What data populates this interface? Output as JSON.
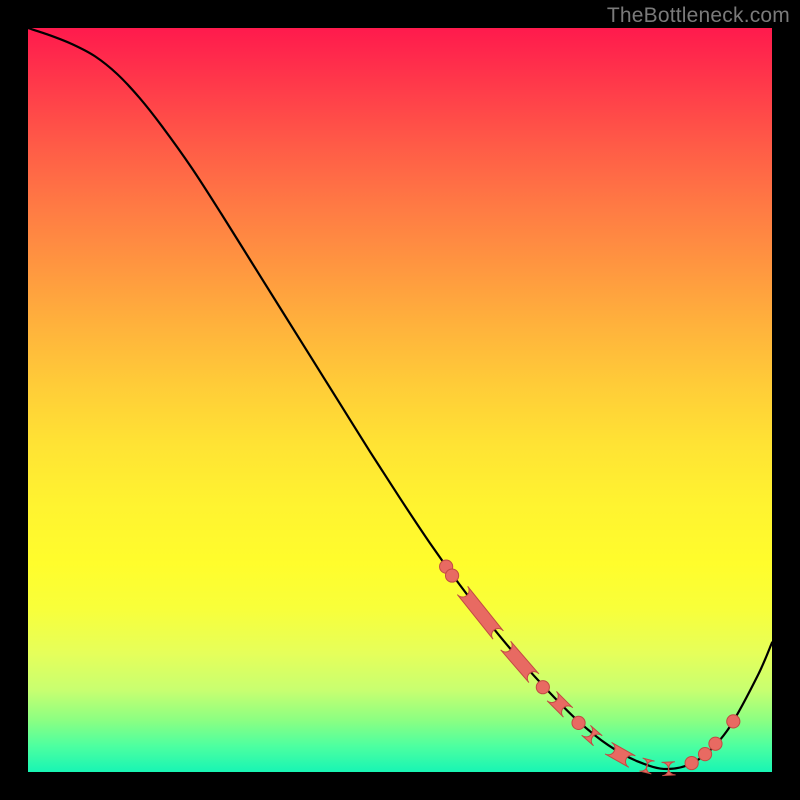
{
  "watermark": "TheBottleneck.com",
  "colors": {
    "curve": "#000000",
    "marker_fill": "#e86a62",
    "marker_stroke": "#c24b43"
  },
  "chart_data": {
    "type": "line",
    "title": "",
    "xlabel": "",
    "ylabel": "",
    "xlim": [
      0,
      100
    ],
    "ylim": [
      0,
      100
    ],
    "series": [
      {
        "name": "bottleneck-curve",
        "x": [
          0,
          3,
          6,
          9,
          12,
          15,
          18,
          22,
          26,
          30,
          34,
          38,
          42,
          46,
          50,
          54,
          58,
          62,
          66,
          70,
          74,
          78,
          82,
          86,
          90,
          94,
          98,
          100
        ],
        "y": [
          100,
          99,
          97.8,
          96.2,
          93.8,
          90.6,
          86.8,
          81.2,
          75.0,
          68.6,
          62.2,
          55.8,
          49.4,
          43.0,
          36.8,
          30.8,
          25.2,
          20.0,
          15.2,
          10.8,
          6.8,
          3.6,
          1.4,
          0.4,
          1.6,
          5.6,
          12.8,
          17.4
        ]
      }
    ],
    "markers": [
      {
        "kind": "dot",
        "x": 56.2,
        "y": 27.6
      },
      {
        "kind": "dot",
        "x": 57.0,
        "y": 26.4
      },
      {
        "kind": "lozenge",
        "x0": 58.4,
        "y0": 24.4,
        "x1": 63.2,
        "y1": 18.4
      },
      {
        "kind": "lozenge",
        "x0": 64.2,
        "y0": 17.0,
        "x1": 68.0,
        "y1": 12.6
      },
      {
        "kind": "dot",
        "x": 69.2,
        "y": 11.4
      },
      {
        "kind": "lozenge",
        "x0": 70.4,
        "y0": 10.2,
        "x1": 72.6,
        "y1": 8.0
      },
      {
        "kind": "dot",
        "x": 74.0,
        "y": 6.6
      },
      {
        "kind": "lozenge",
        "x0": 75.0,
        "y0": 5.6,
        "x1": 76.6,
        "y1": 4.2
      },
      {
        "kind": "lozenge",
        "x0": 78.0,
        "y0": 3.2,
        "x1": 81.2,
        "y1": 1.4
      },
      {
        "kind": "lozenge",
        "x0": 82.4,
        "y0": 1.0,
        "x1": 84.0,
        "y1": 0.6
      },
      {
        "kind": "lozenge",
        "x0": 85.2,
        "y0": 0.4,
        "x1": 87.0,
        "y1": 0.5
      },
      {
        "kind": "dot",
        "x": 89.2,
        "y": 1.2
      },
      {
        "kind": "dot",
        "x": 91.0,
        "y": 2.4
      },
      {
        "kind": "dot",
        "x": 92.4,
        "y": 3.8
      },
      {
        "kind": "dot",
        "x": 94.8,
        "y": 6.8
      }
    ]
  }
}
